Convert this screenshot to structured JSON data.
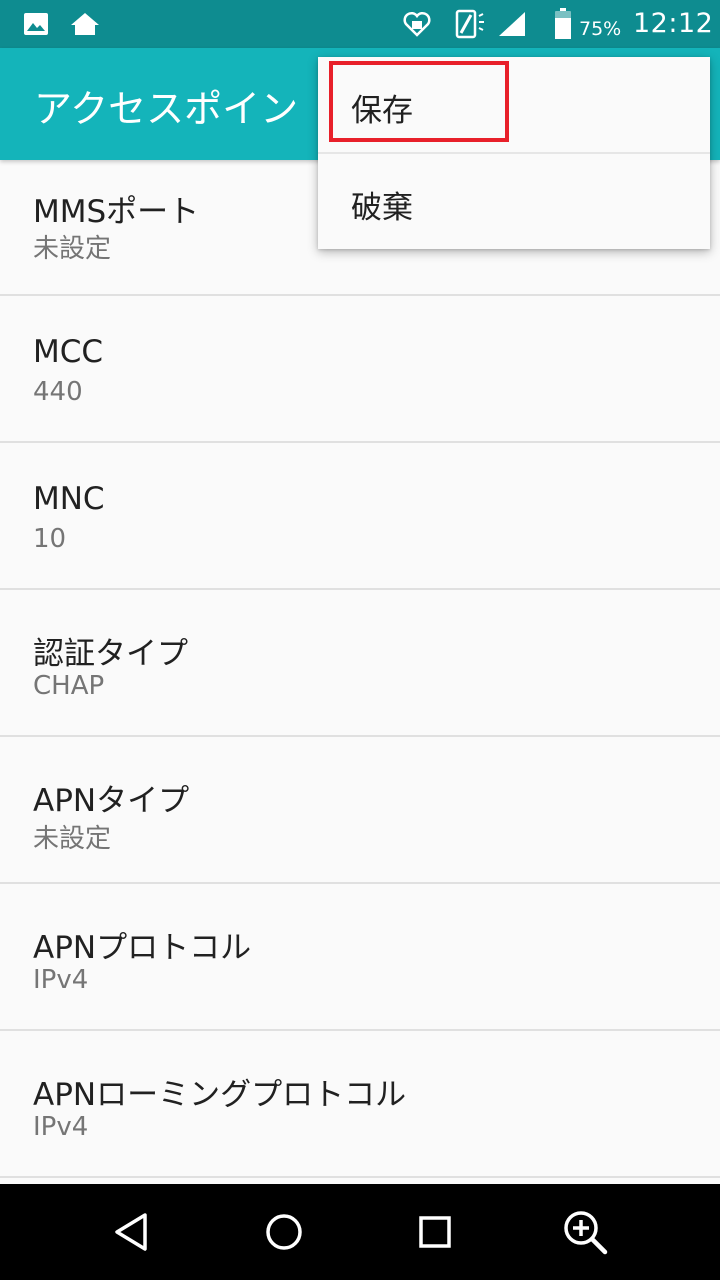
{
  "status_bar": {
    "icons": [
      "image-icon",
      "home-icon",
      "wellness-icon",
      "vibrate-icon",
      "signal-icon",
      "battery-icon"
    ],
    "battery_percent": "75%",
    "time": "12:12"
  },
  "app_bar": {
    "title": "アクセスポイン"
  },
  "settings": [
    {
      "label": "MMSポート",
      "value": "未設定"
    },
    {
      "label": "MCC",
      "value": "440"
    },
    {
      "label": "MNC",
      "value": "10"
    },
    {
      "label": "認証タイプ",
      "value": "CHAP"
    },
    {
      "label": "APNタイプ",
      "value": "未設定"
    },
    {
      "label": "APNプロトコル",
      "value": "IPv4"
    },
    {
      "label": "APNローミングプロトコル",
      "value": "IPv4"
    }
  ],
  "overflow_menu": {
    "items": [
      {
        "label": "保存"
      },
      {
        "label": "破棄"
      }
    ],
    "highlight_color": "#e8202a"
  },
  "nav_bar": {
    "buttons": [
      "back-icon",
      "home-circle-icon",
      "recents-icon",
      "zoom-in-icon"
    ]
  },
  "colors": {
    "status_bar": "#0e8c90",
    "app_bar": "#14b4ba"
  }
}
